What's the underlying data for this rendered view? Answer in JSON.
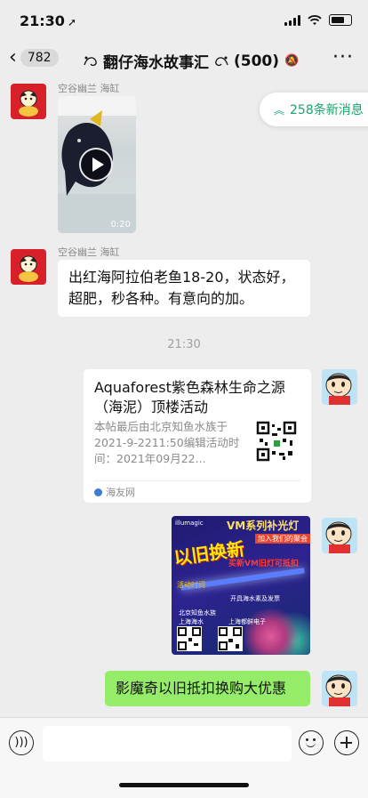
{
  "status_bar": {
    "time": "21:30",
    "location_icon": "location-arrow"
  },
  "nav": {
    "back_count": "782",
    "title": "翻仔海水故事汇",
    "member_count": "(500)",
    "muted": true
  },
  "new_messages": {
    "label": "258条新消息",
    "icon": "double-chevron-up"
  },
  "messages": [
    {
      "type": "video",
      "sender": "空谷幽兰 海缸",
      "duration": "0:20",
      "avatar": "red-cartoon"
    },
    {
      "type": "text",
      "sender": "空谷幽兰 海缸",
      "text": "出红海阿拉伯老鱼18-20，状态好，超肥，秒各种。有意向的加。",
      "avatar": "red-cartoon"
    },
    {
      "type": "time",
      "text": "21:30"
    },
    {
      "type": "link",
      "title": "Aquaforest紫色森林生命之源（海泥）顶楼活动",
      "description": "本帖最后由北京知鱼水族于2021-9-2211:50编辑活动时间：2021年09月22...",
      "source": "海友网",
      "self": true
    },
    {
      "type": "image",
      "self": true,
      "image_text": {
        "logo": "illumagic",
        "headline": "VM系列补光灯",
        "sub": "加入我们的聚会",
        "big": "以旧换新",
        "red": "买新VM旧灯可抵扣",
        "tag": "活动时间",
        "line1": "开具海水素及发票",
        "line2": "北京知鱼水族",
        "line3": "上海海水",
        "line4": "上海都鲜电子"
      }
    },
    {
      "type": "text",
      "self": true,
      "text": "影魔奇以旧抵扣换购大优惠"
    }
  ],
  "input_bar": {
    "voice_icon": "voice-icon",
    "emoji_icon": "emoji-icon",
    "plus_icon": "plus-icon"
  },
  "colors": {
    "green_bubble": "#95ec69",
    "accent": "#17a66b",
    "background": "#ededed"
  }
}
